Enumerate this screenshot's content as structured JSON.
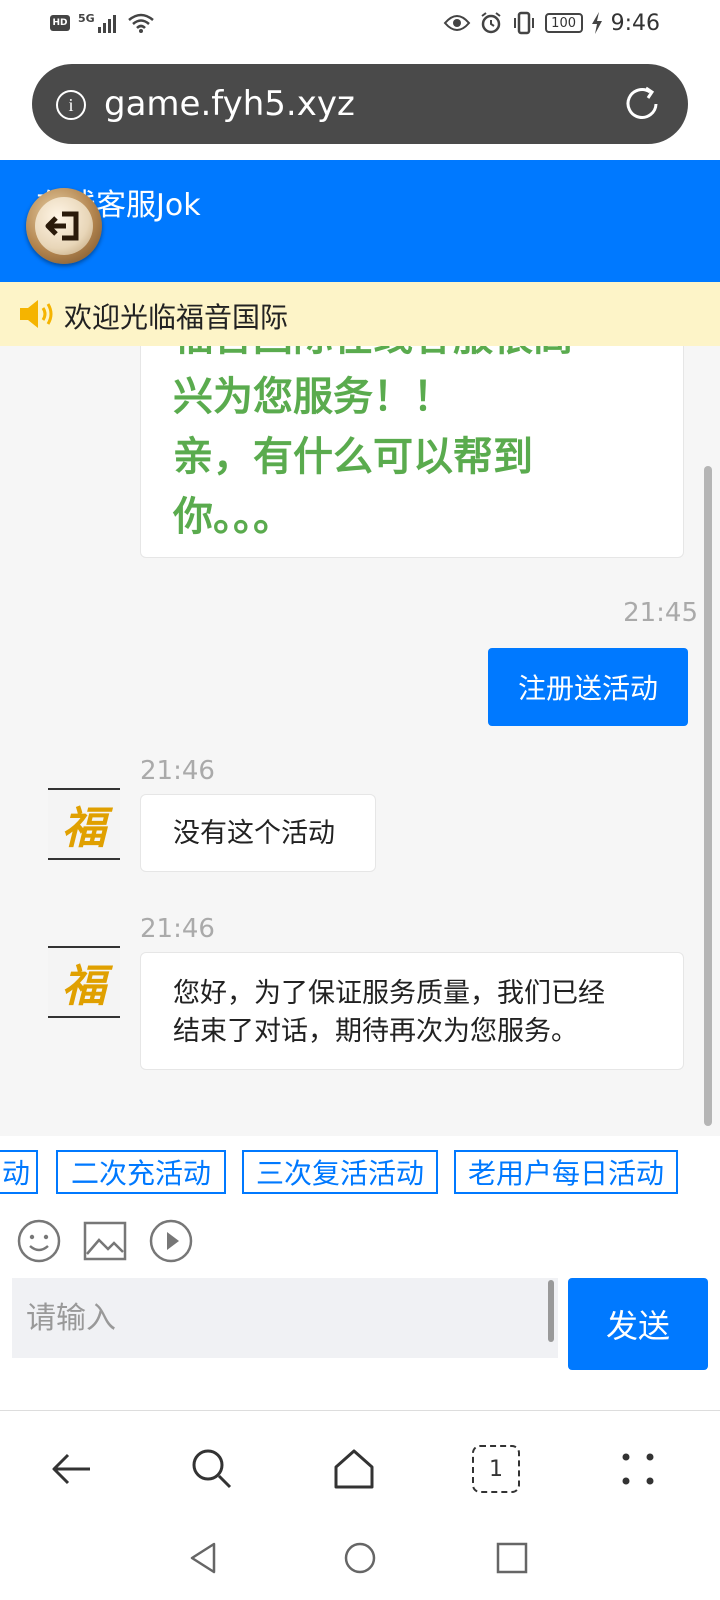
{
  "status_bar": {
    "hd": "HD",
    "network": "5G",
    "battery": "100",
    "time": "9:46"
  },
  "url_bar": {
    "url": "game.fyh5.xyz"
  },
  "header": {
    "title": "在线客服Jok"
  },
  "notice": {
    "text": "欢迎光临福音国际"
  },
  "chat": {
    "welcome_lines": [
      "福音国际在线客服很高",
      "兴为您服务！！",
      "亲，有什么可以帮到",
      "你。。。"
    ],
    "messages": [
      {
        "from": "user",
        "time": "21:45",
        "text": "注册送活动"
      },
      {
        "from": "agent",
        "time": "21:46",
        "text": "没有这个活动"
      },
      {
        "from": "agent",
        "time": "21:46",
        "text_lines": [
          "您好，为了保证服务质量，我们已经",
          "结束了对话，期待再次为您服务。"
        ]
      }
    ],
    "avatar_char": "福"
  },
  "quick_replies": [
    "动",
    "二次充活动",
    "三次复活活动",
    "老用户每日活动"
  ],
  "input": {
    "placeholder": "请输入",
    "send_label": "发送"
  },
  "browser_nav": {
    "tabs_count": "1"
  },
  "colors": {
    "accent": "#0079ff",
    "welcome_green": "#5aab4e",
    "notice_bg": "#fdf4c8"
  }
}
